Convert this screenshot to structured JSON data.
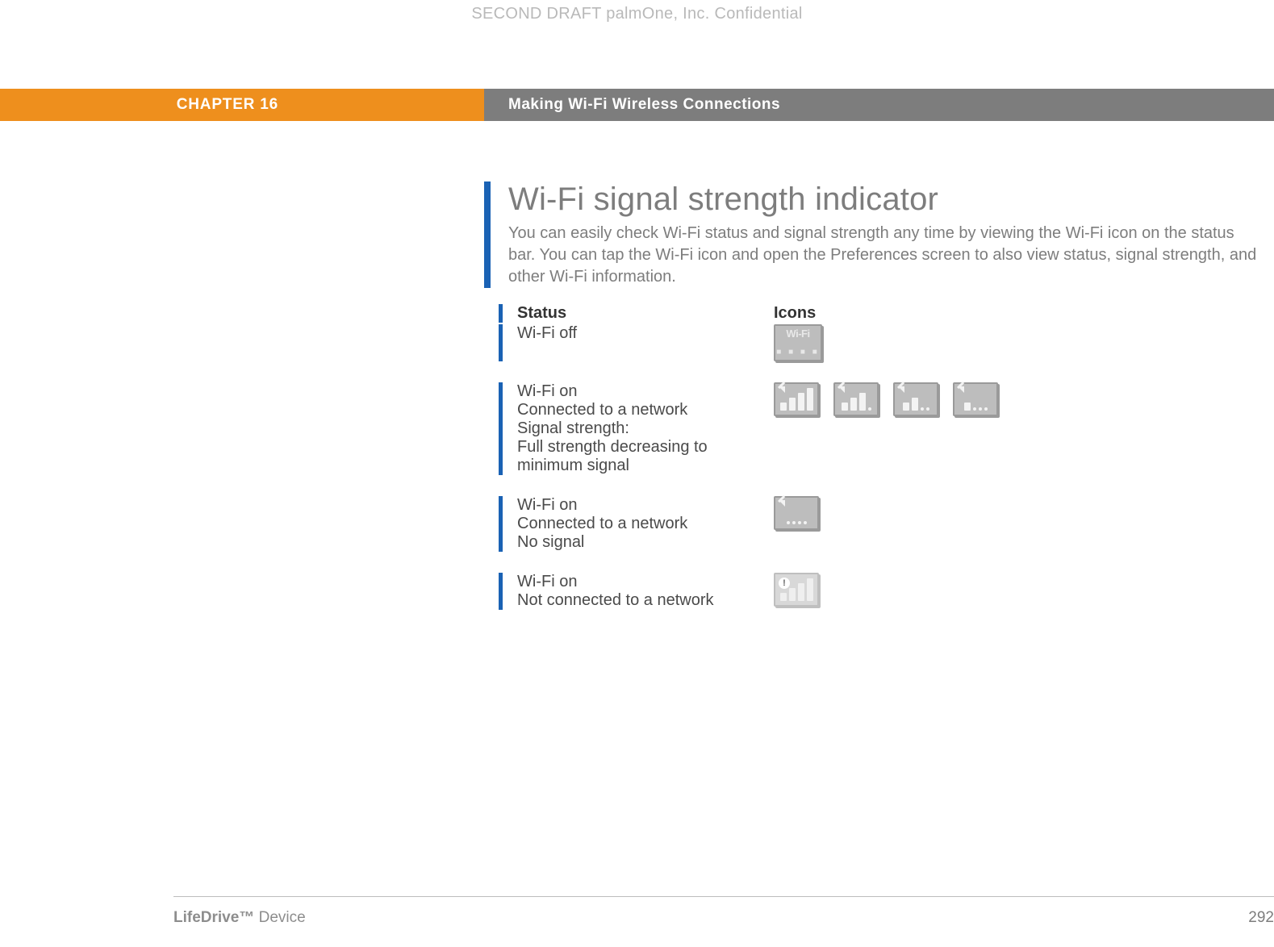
{
  "draft_line": "SECOND DRAFT palmOne, Inc.  Confidential",
  "header": {
    "chapter": "CHAPTER 16",
    "title": "Making Wi-Fi Wireless Connections"
  },
  "section": {
    "heading": "Wi-Fi signal strength indicator",
    "body": "You can easily check Wi-Fi status and signal strength any time by viewing the Wi-Fi icon on the status bar. You can tap the Wi-Fi icon and open the Preferences screen to also view status, signal strength, and other Wi-Fi information."
  },
  "table": {
    "head_status": "Status",
    "head_icons": "Icons",
    "rows": [
      {
        "status_lines": [
          "Wi-Fi off"
        ],
        "icon_type": "wifi-off"
      },
      {
        "status_lines": [
          "Wi-Fi on",
          "Connected to a network",
          "Signal strength:",
          "Full strength decreasing to minimum signal"
        ],
        "icon_type": "strength-series"
      },
      {
        "status_lines": [
          "Wi-Fi on",
          "Connected to a network",
          "No signal"
        ],
        "icon_type": "no-signal"
      },
      {
        "status_lines": [
          "Wi-Fi on",
          "Not connected to a network"
        ],
        "icon_type": "not-connected"
      }
    ]
  },
  "wifi_off_label": "Wi-Fi",
  "footer": {
    "product_bold": "LifeDrive™",
    "product_light": "Device",
    "page": "292"
  }
}
